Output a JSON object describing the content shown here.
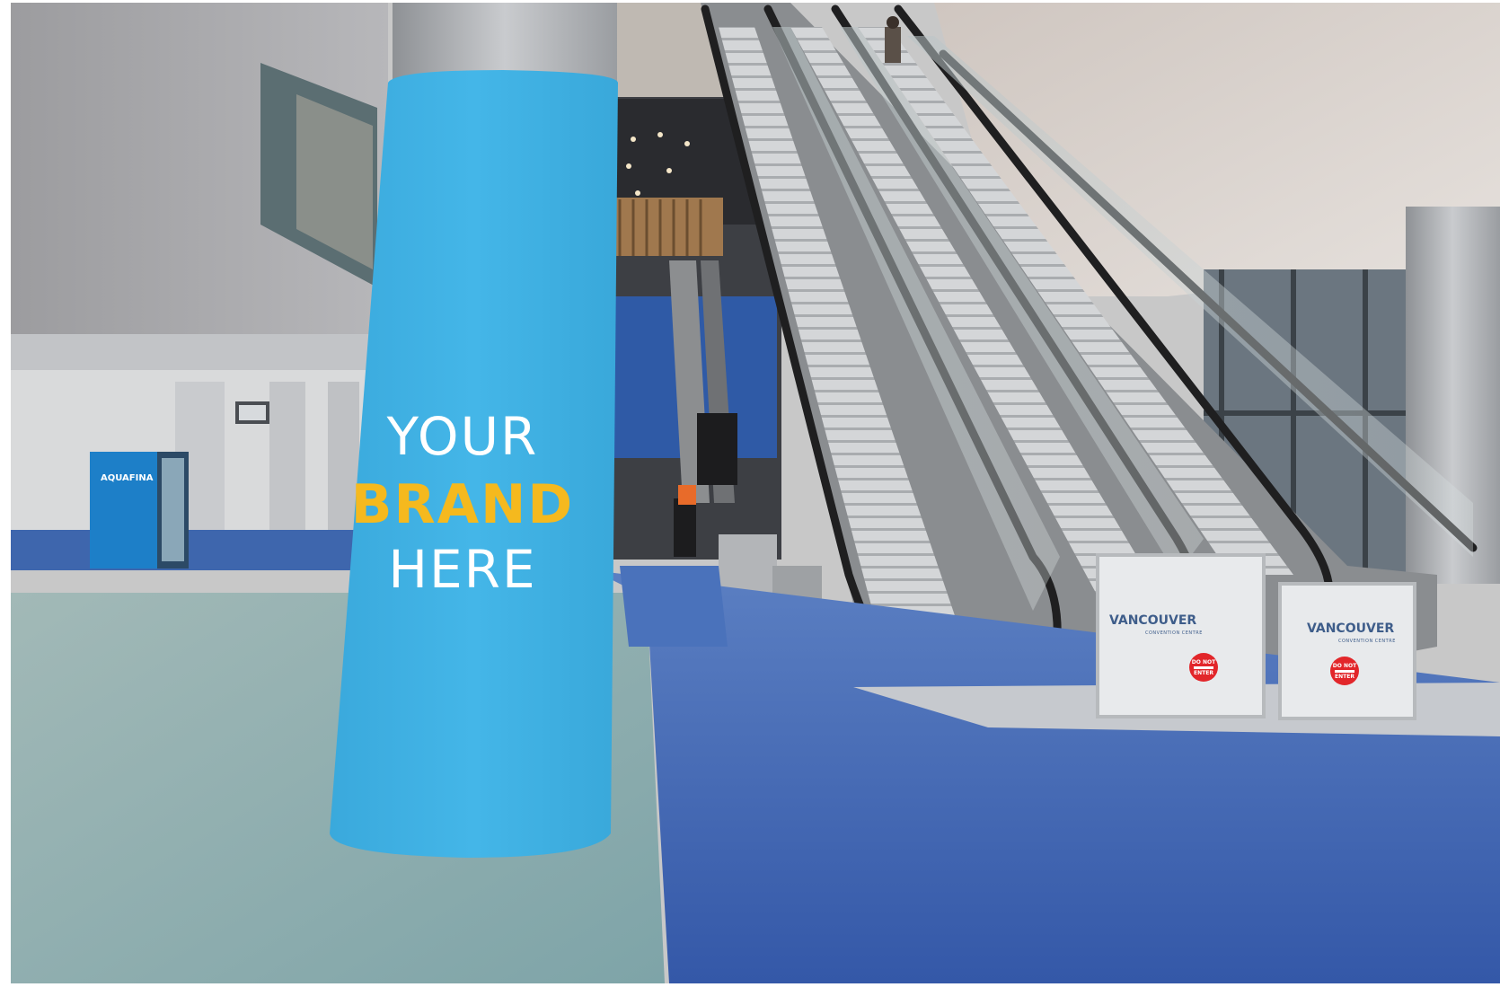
{
  "column_wrap": {
    "line1": "YOUR",
    "line2": "BRAND",
    "line3": "HERE",
    "wrap_color": "#3fb2e4",
    "accent_color": "#f5b91e"
  },
  "barriers": [
    {
      "logo": "VANCOUVER",
      "sub": "CONVENTION CENTRE",
      "badge_top": "DO NOT",
      "badge_bottom": "ENTER"
    },
    {
      "logo": "VANCOUVER",
      "sub": "CONVENTION CENTRE",
      "badge_top": "DO NOT",
      "badge_bottom": "ENTER"
    }
  ],
  "vending_machine": {
    "label": "AQUAFINA",
    "color": "#1d7fc8"
  },
  "colors": {
    "floor_blue": "#3b66b8",
    "floor_tile": "#8fb3b4",
    "wall": "#a9a9ab",
    "ceiling": "#d9d3cf"
  }
}
